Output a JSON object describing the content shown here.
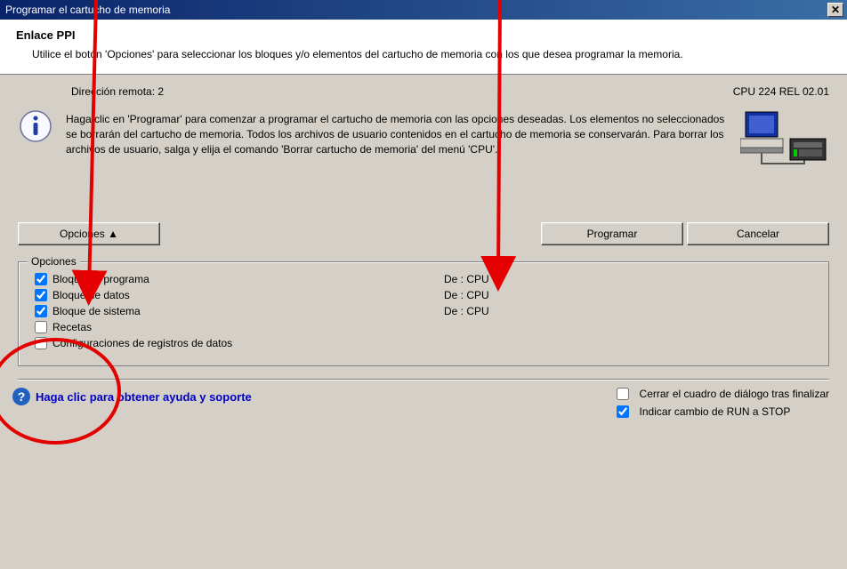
{
  "window": {
    "title": "Programar el cartucho de memoria"
  },
  "header": {
    "title": "Enlace PPI",
    "description": "Utilice el botón 'Opciones' para seleccionar los bloques y/o elementos del cartucho de memoria con los que desea programar la memoria."
  },
  "info": {
    "remote_label": "Dirección remota: 2",
    "cpu_label": "CPU 224 REL 02.01",
    "instructions": "Haga clic en 'Programar' para comenzar a programar el cartucho de memoria con las opciones deseadas. Los elementos no seleccionados se borrarán del cartucho de memoria. Todos los archivos de usuario contenidos en el cartucho de memoria se conservarán. Para borrar los archivos de usuario, salga y elija el comando 'Borrar cartucho de memoria' del menú 'CPU'."
  },
  "buttons": {
    "options": "Opciones  ▲",
    "program": "Programar",
    "cancel": "Cancelar"
  },
  "options_group": {
    "legend": "Opciones",
    "items": [
      {
        "label": "Bloque de programa",
        "checked": true,
        "source": "De : CPU"
      },
      {
        "label": "Bloque de datos",
        "checked": true,
        "source": "De : CPU"
      },
      {
        "label": "Bloque de sistema",
        "checked": true,
        "source": "De : CPU"
      },
      {
        "label": "Recetas",
        "checked": false,
        "source": ""
      },
      {
        "label": "Configuraciones de registros de datos",
        "checked": false,
        "source": ""
      }
    ]
  },
  "footer": {
    "help_text": "Haga clic para obtener ayuda y soporte",
    "checks": [
      {
        "label": "Cerrar el cuadro de diálogo tras finalizar",
        "checked": false
      },
      {
        "label": "Indicar cambio de RUN a STOP",
        "checked": true
      }
    ]
  }
}
